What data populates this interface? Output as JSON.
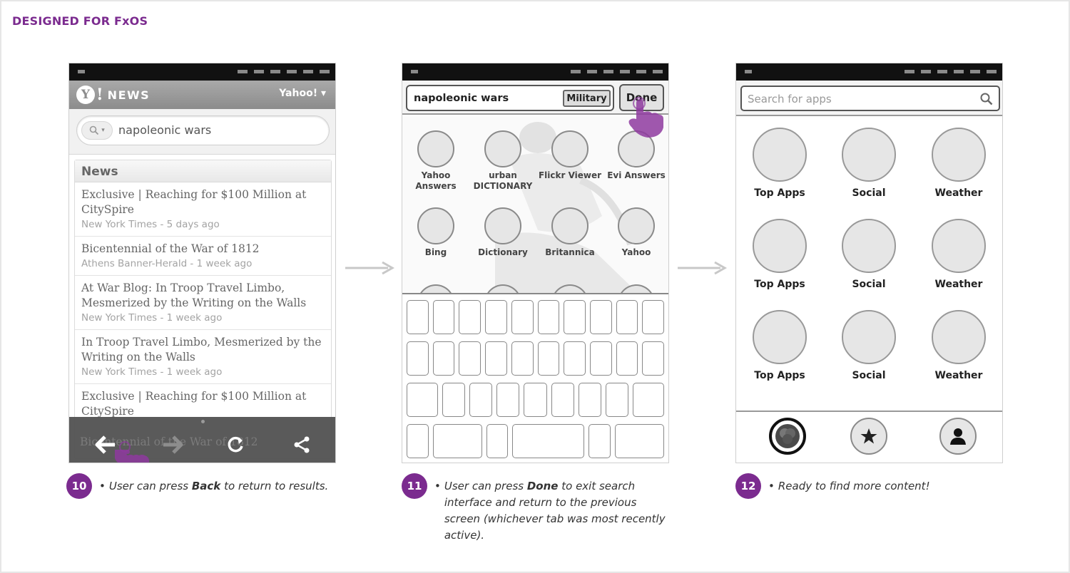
{
  "page_title": "DESIGNED FOR FxOS",
  "colors": {
    "accent": "#7b2b8f",
    "arrow": "#c8c8c8",
    "status_bar": "#111111"
  },
  "phone1": {
    "logo_letter": "Y",
    "logo_excl": "!",
    "logo_text": "NEWS",
    "region": "Yahoo! ▾",
    "search_value": "napoleonic wars",
    "list_header": "News",
    "items": [
      {
        "title": "Exclusive | Reaching for $100 Million at CitySpire",
        "meta": "New York Times - 5 days ago"
      },
      {
        "title": "Bicentennial of the War of 1812",
        "meta": "Athens Banner-Herald - 1 week ago"
      },
      {
        "title": "At War Blog: In Troop Travel Limbo, Mesmerized by the Writing on the Walls",
        "meta": "New York Times - 1 week ago"
      },
      {
        "title": "In Troop Travel Limbo, Mesmerized by the Writing on the Walls",
        "meta": "New York Times - 1 week ago"
      },
      {
        "title": "Exclusive | Reaching for $100 Million at CitySpire",
        "meta": ""
      }
    ],
    "faded_text": "Bicentennial of the War of 1812",
    "toolbar_icons": [
      "back-icon",
      "forward-icon",
      "reload-icon",
      "share-icon"
    ]
  },
  "phone2": {
    "search_value": "napoleonic wars",
    "filter_chip": "Military",
    "done_label": "Done",
    "apps": [
      {
        "label": "Yahoo Answers"
      },
      {
        "label": "urban DICTIONARY"
      },
      {
        "label": "Flickr Viewer"
      },
      {
        "label": "Evi Answers"
      },
      {
        "label": "Bing"
      },
      {
        "label": "Dictionary"
      },
      {
        "label": "Britannica"
      },
      {
        "label": "Yahoo"
      }
    ]
  },
  "phone3": {
    "search_placeholder": "Search for apps",
    "apps": [
      {
        "label": "Top Apps"
      },
      {
        "label": "Social"
      },
      {
        "label": "Weather"
      },
      {
        "label": "Top Apps"
      },
      {
        "label": "Social"
      },
      {
        "label": "Weather"
      },
      {
        "label": "Top Apps"
      },
      {
        "label": "Social"
      },
      {
        "label": "Weather"
      }
    ],
    "dock_icons": [
      "apps-icon",
      "star-icon",
      "person-icon"
    ]
  },
  "steps": [
    {
      "number": "10",
      "pre": "User can press ",
      "bold": "Back",
      "post": " to return to results.",
      "extra": ""
    },
    {
      "number": "11",
      "pre": "User can press ",
      "bold": "Done",
      "post": " to exit search",
      "extra": "interface and return to the previous screen (whichever tab was most recently active)."
    },
    {
      "number": "12",
      "pre": "Ready to find more content!",
      "bold": "",
      "post": "",
      "extra": ""
    }
  ]
}
